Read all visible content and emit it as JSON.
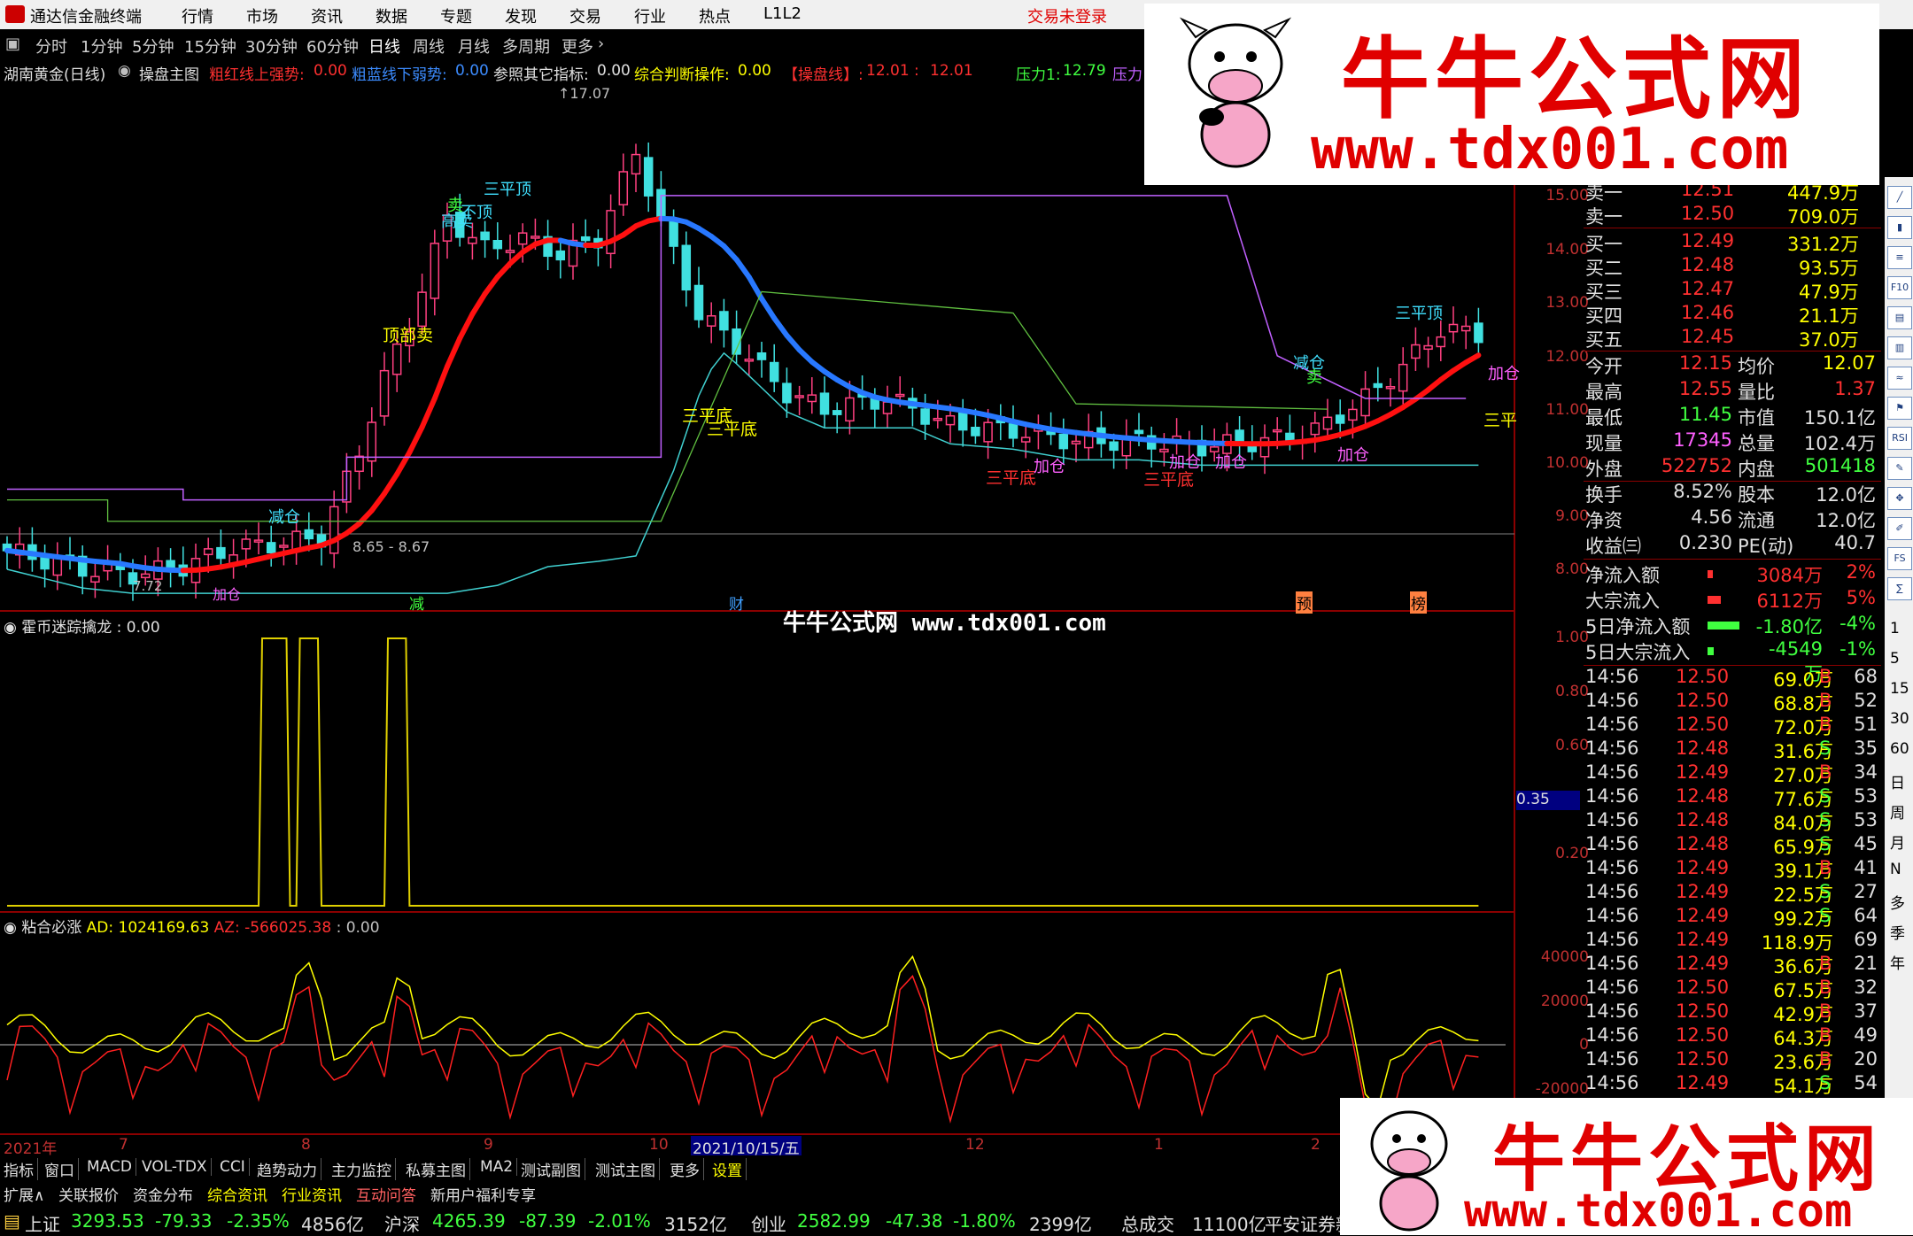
{
  "app": {
    "name": "通达信金融终端",
    "menu": [
      "行情",
      "市场",
      "资讯",
      "数据",
      "专题",
      "发现",
      "交易",
      "行业",
      "热点",
      "L1L2"
    ],
    "login_status": "交易未登录"
  },
  "periods": {
    "items": [
      "分时",
      "1分钟",
      "5分钟",
      "15分钟",
      "30分钟",
      "60分钟",
      "日线",
      "周线",
      "月线",
      "多周期",
      "更多"
    ],
    "active": "日线"
  },
  "main_indicator": {
    "stock": "湖南黄金(日线)",
    "name": "操盘主图",
    "items": [
      {
        "label": "粗红线上强势:",
        "value": "0.00",
        "color": "#ff3030"
      },
      {
        "label": "粗蓝线下弱势:",
        "value": "0.00",
        "color": "#3c8cff"
      },
      {
        "label": "参照其它指标:",
        "value": "0.00",
        "color": "#e0e0e0"
      },
      {
        "label": "综合判断操作:",
        "value": "0.00",
        "color": "#ffff00"
      },
      {
        "label": "【操盘线】:",
        "value": "12.01",
        "color": "#ff3030"
      },
      {
        "label": ":",
        "value": "12.01",
        "color": "#ff3030"
      },
      {
        "label": "压力1:",
        "value": "12.79",
        "color": "#40ff40"
      },
      {
        "label": "压力",
        "value": "",
        "color": "#c060ff"
      }
    ],
    "y_labels": [
      "15.00",
      "14.00",
      "13.00",
      "12.00",
      "11.00",
      "10.00",
      "9.00",
      "8.00"
    ],
    "high_label": "17.07",
    "low_label": "8.65 - 8.67",
    "low_price": "7.72",
    "annotations": [
      {
        "text": "三平顶",
        "color": "#40e0ff"
      },
      {
        "text": "卖",
        "color": "#40ff40"
      },
      {
        "text": "不顶",
        "color": "#40e0ff"
      },
      {
        "text": "高卖",
        "color": "#40e0ff"
      },
      {
        "text": "顶部卖",
        "color": "#ffff00"
      },
      {
        "text": "减仓",
        "color": "#40e0ff"
      },
      {
        "text": "加仓",
        "color": "#ff60ff"
      },
      {
        "text": "三平底",
        "color": "#ffff00"
      },
      {
        "text": "三平底",
        "color": "#ffff00"
      },
      {
        "text": "三平底",
        "color": "#ff3030"
      },
      {
        "text": "加仓",
        "color": "#ff60ff"
      },
      {
        "text": "三平底",
        "color": "#ff3030"
      },
      {
        "text": "加仓",
        "color": "#ff60ff"
      },
      {
        "text": "加仓",
        "color": "#ff60ff"
      },
      {
        "text": "加仓",
        "color": "#ff60ff"
      },
      {
        "text": "减仓",
        "color": "#40e0ff"
      },
      {
        "text": "卖",
        "color": "#40ff40"
      },
      {
        "text": "三平顶",
        "color": "#40e0ff"
      },
      {
        "text": "加仓",
        "color": "#ff60ff"
      },
      {
        "text": "三平",
        "color": "#ffff00"
      }
    ],
    "events": [
      {
        "text": "减",
        "color": "#40ff40"
      },
      {
        "text": "财",
        "color": "#40a0ff"
      },
      {
        "text": "预",
        "color": "#ff8040"
      },
      {
        "text": "榜",
        "color": "#ff8040"
      }
    ]
  },
  "sub1": {
    "title": "霍币迷踪擒龙",
    "value": "0.00",
    "y_labels": [
      "1.00",
      "0.80",
      "0.60",
      "0.20"
    ],
    "marker": "0.35"
  },
  "sub2": {
    "title": "粘合必涨",
    "ad_label": "AD:",
    "ad_value": "1024169.63",
    "az_label": "AZ:",
    "az_value": "-566025.38",
    "extra": ": 0.00",
    "y_labels": [
      "40000",
      "20000",
      "0",
      "-20000"
    ]
  },
  "time_axis": {
    "labels": [
      "2021年",
      "7",
      "8",
      "9",
      "10",
      "2021/10/15/五",
      "12",
      "1",
      "2"
    ]
  },
  "tabs1": [
    "指标",
    "窗口",
    "MACD",
    "VOL-TDX",
    "CCI",
    "趋势动力",
    "主力监控",
    "私募主图",
    "MA2",
    "测试副图",
    "测试主图",
    "更多",
    "设置"
  ],
  "tabs2": [
    {
      "t": "扩展∧",
      "c": "#e0e0e0"
    },
    {
      "t": "关联报价",
      "c": "#e0e0e0"
    },
    {
      "t": "资金分布",
      "c": "#e0e0e0"
    },
    {
      "t": "综合资讯",
      "c": "#ffff00"
    },
    {
      "t": "行业资讯",
      "c": "#ffff00"
    },
    {
      "t": "互动问答",
      "c": "#ff6060"
    },
    {
      "t": "新用户福利专享",
      "c": "#e0e0e0"
    }
  ],
  "status": {
    "indices": [
      {
        "name": "上证",
        "value": "3293.53",
        "chg": "-79.33",
        "pct": "-2.35%",
        "amt": "4856亿"
      },
      {
        "name": "沪深",
        "value": "4265.39",
        "chg": "-87.39",
        "pct": "-2.01%",
        "amt": "3152亿"
      },
      {
        "name": "创业",
        "value": "2582.99",
        "chg": "-47.38",
        "pct": "-1.80%",
        "amt": "2399亿"
      }
    ],
    "total_label": "总成交",
    "total_value": "11100亿",
    "broker": "平安证券新"
  },
  "order_book": {
    "asks": [
      {
        "l": "卖一",
        "p": "12.51",
        "v": "447.9万"
      },
      {
        "l": "卖一",
        "p": "12.50",
        "v": "709.0万"
      }
    ],
    "bids": [
      {
        "l": "买一",
        "p": "12.49",
        "v": "331.2万"
      },
      {
        "l": "买二",
        "p": "12.48",
        "v": "93.5万"
      },
      {
        "l": "买三",
        "p": "12.47",
        "v": "47.9万"
      },
      {
        "l": "买四",
        "p": "12.46",
        "v": "21.1万"
      },
      {
        "l": "买五",
        "p": "12.45",
        "v": "37.0万"
      }
    ]
  },
  "stats": [
    {
      "l": "今开",
      "v": "12.15",
      "l2": "均价",
      "v2": "12.07",
      "c": "#ff3030",
      "c2": "#ffff00"
    },
    {
      "l": "最高",
      "v": "12.55",
      "l2": "量比",
      "v2": "1.37",
      "c": "#ff3030",
      "c2": "#ff3030"
    },
    {
      "l": "最低",
      "v": "11.45",
      "l2": "市值",
      "v2": "150.1亿",
      "c": "#40ff40",
      "c2": "#e0e0e0"
    },
    {
      "l": "现量",
      "v": "17345",
      "l2": "总量",
      "v2": "102.4万",
      "c": "#ff60ff",
      "c2": "#e0e0e0"
    },
    {
      "l": "外盘",
      "v": "522752",
      "l2": "内盘",
      "v2": "501418",
      "c": "#ff3030",
      "c2": "#40ff40"
    },
    {
      "l": "换手",
      "v": "8.52%",
      "l2": "股本",
      "v2": "12.0亿",
      "c": "#e0e0e0",
      "c2": "#e0e0e0"
    },
    {
      "l": "净资",
      "v": "4.56",
      "l2": "流通",
      "v2": "12.0亿",
      "c": "#e0e0e0",
      "c2": "#e0e0e0"
    },
    {
      "l": "收益㈢",
      "v": "0.230",
      "l2": "PE(动)",
      "v2": "40.7",
      "c": "#e0e0e0",
      "c2": "#e0e0e0"
    }
  ],
  "flows": [
    {
      "l": "净流入额",
      "v": "3084万",
      "p": "2%",
      "c": "#ff3030",
      "bar": 0.1
    },
    {
      "l": "大宗流入",
      "v": "6112万",
      "p": "5%",
      "c": "#ff3030",
      "bar": 0.25
    },
    {
      "l": "5日净流入额",
      "v": "-1.80亿",
      "p": "-4%",
      "c": "#40ff40",
      "bar": 0.6
    },
    {
      "l": "5日大宗流入",
      "v": "-4549万",
      "p": "-1%",
      "c": "#40ff40",
      "bar": 0.12
    }
  ],
  "ticks": [
    {
      "t": "14:56",
      "p": "12.50",
      "v": "69.0万",
      "s": "B",
      "n": "68"
    },
    {
      "t": "14:56",
      "p": "12.50",
      "v": "68.8万",
      "s": "B",
      "n": "52"
    },
    {
      "t": "14:56",
      "p": "12.50",
      "v": "72.0万",
      "s": "B",
      "n": "51"
    },
    {
      "t": "14:56",
      "p": "12.48",
      "v": "31.6万",
      "s": "S",
      "n": "35"
    },
    {
      "t": "14:56",
      "p": "12.49",
      "v": "27.0万",
      "s": "B",
      "n": "34"
    },
    {
      "t": "14:56",
      "p": "12.48",
      "v": "77.6万",
      "s": "S",
      "n": "53"
    },
    {
      "t": "14:56",
      "p": "12.48",
      "v": "84.0万",
      "s": "S",
      "n": "53"
    },
    {
      "t": "14:56",
      "p": "12.48",
      "v": "65.9万",
      "s": "S",
      "n": "45"
    },
    {
      "t": "14:56",
      "p": "12.49",
      "v": "39.1万",
      "s": "B",
      "n": "41"
    },
    {
      "t": "14:56",
      "p": "12.49",
      "v": "22.5万",
      "s": "S",
      "n": "27"
    },
    {
      "t": "14:56",
      "p": "12.49",
      "v": "99.2万",
      "s": "S",
      "n": "64"
    },
    {
      "t": "14:56",
      "p": "12.49",
      "v": "118.9万",
      "s": "",
      "n": "69"
    },
    {
      "t": "14:56",
      "p": "12.49",
      "v": "36.6万",
      "s": "B",
      "n": "21"
    },
    {
      "t": "14:56",
      "p": "12.50",
      "v": "67.5万",
      "s": "B",
      "n": "32"
    },
    {
      "t": "14:56",
      "p": "12.50",
      "v": "42.9万",
      "s": "B",
      "n": "37"
    },
    {
      "t": "14:56",
      "p": "12.50",
      "v": "64.3万",
      "s": "B",
      "n": "49"
    },
    {
      "t": "14:56",
      "p": "12.50",
      "v": "23.6万",
      "s": "B",
      "n": "20"
    },
    {
      "t": "14:56",
      "p": "12.49",
      "v": "54.1万",
      "s": "S",
      "n": "54"
    }
  ],
  "right_tools": {
    "icons": [
      "trend-icon",
      "kline-icon",
      "list-icon",
      "f10-icon",
      "doc-icon",
      "chart-icon",
      "flow-icon",
      "flag-icon",
      "rsi-icon",
      "tools-icon",
      "move-icon",
      "pen-icon",
      "fs-icon",
      "sym-icon"
    ],
    "chars": [
      "1",
      "5",
      "15",
      "30",
      "60",
      "日",
      "周",
      "月",
      "N",
      "多",
      "季",
      "年"
    ]
  },
  "watermark": {
    "title": "牛牛公式网",
    "url": "www.tdx001.com",
    "center_text": "牛牛公式网 www.tdx001.com"
  }
}
